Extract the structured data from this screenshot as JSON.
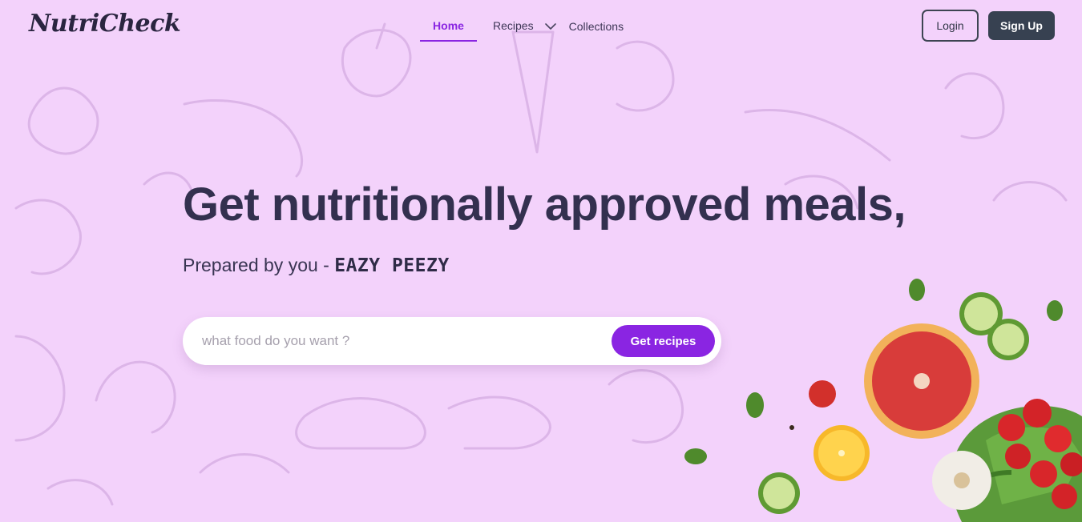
{
  "brand": {
    "name": "NutriCheck"
  },
  "nav": {
    "home": "Home",
    "recipes": "Recipes",
    "collections": "Collections"
  },
  "auth": {
    "login": "Login",
    "signup": "Sign Up"
  },
  "hero": {
    "title": "Get nutritionally approved meals,",
    "subtitle_prefix": "Prepared by you - ",
    "subtitle_accent": "EAZY PEEZY"
  },
  "search": {
    "placeholder": "what food do you want ?",
    "value": "",
    "button": "Get recipes"
  },
  "colors": {
    "background": "#f3d2fb",
    "accent": "#8a25e2",
    "dark_button": "#374151",
    "heading": "#33304f"
  }
}
